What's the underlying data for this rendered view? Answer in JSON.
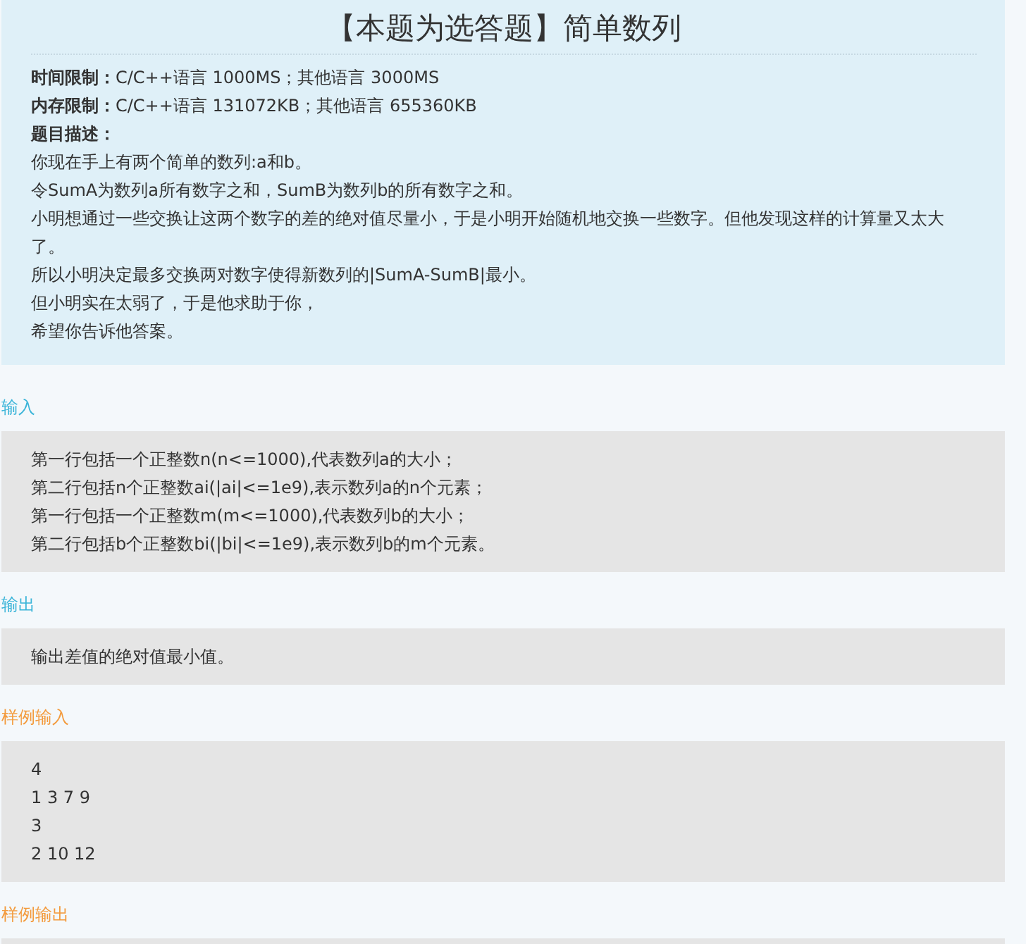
{
  "title": "【本题为选答题】简单数列",
  "limits": [
    {
      "label": "时间限制：",
      "value": "C/C++语言 1000MS；其他语言 3000MS"
    },
    {
      "label": "内存限制：",
      "value": "C/C++语言 131072KB；其他语言 655360KB"
    }
  ],
  "description": {
    "label": "题目描述：",
    "lines": [
      "你现在手上有两个简单的数列:a和b。",
      "令SumA为数列a所有数字之和，SumB为数列b的所有数字之和。",
      "小明想通过一些交换让这两个数字的差的绝对值尽量小，于是小明开始随机地交换一些数字。但他发现这样的计算量又太大了。",
      "所以小明决定最多交换两对数字使得新数列的|SumA-SumB|最小。",
      "但小明实在太弱了，于是他求助于你，",
      "希望你告诉他答案。"
    ]
  },
  "sections": [
    {
      "heading": "输入",
      "color": "#3ab4d8",
      "lines": [
        "第一行包括一个正整数n(n<=1000),代表数列a的大小；",
        "第二行包括n个正整数ai(|ai|<=1e9),表示数列a的n个元素；",
        "第一行包括一个正整数m(m<=1000),代表数列b的大小；",
        "第二行包括b个正整数bi(|bi|<=1e9),表示数列b的m个元素。"
      ]
    },
    {
      "heading": "输出",
      "color": "#3ab4d8",
      "lines": [
        "输出差值的绝对值最小值。"
      ]
    },
    {
      "heading": "样例输入",
      "color": "#f39a3c",
      "lines": [
        "4",
        "1 3 7 9",
        "3",
        "2 10 12"
      ]
    },
    {
      "heading": "样例输出",
      "color": "#f39a3c"
    }
  ]
}
